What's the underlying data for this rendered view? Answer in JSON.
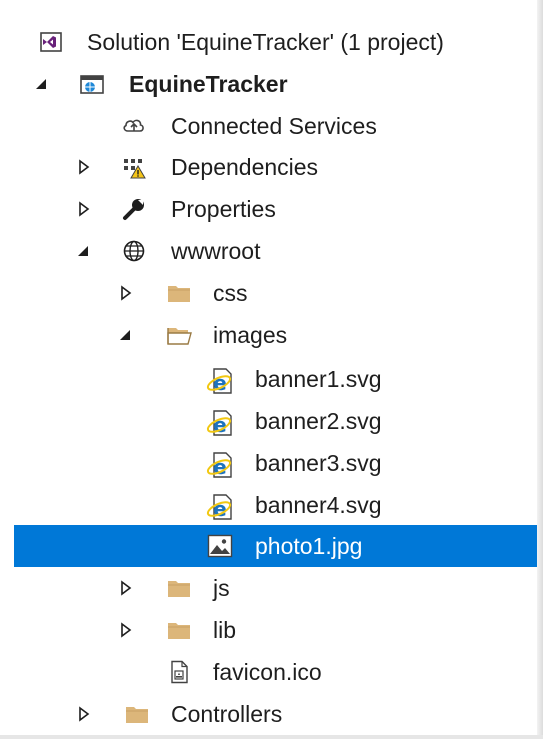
{
  "solution_explorer": {
    "solution": {
      "label": "Solution 'EquineTracker' (1 project)",
      "icon": "visual-studio-solution-icon"
    },
    "project": {
      "label": "EquineTracker",
      "icon": "web-project-icon",
      "expanded": true
    },
    "items": {
      "connected_services": {
        "label": "Connected Services",
        "icon": "connected-services-icon"
      },
      "dependencies": {
        "label": "Dependencies",
        "icon": "dependencies-warning-icon",
        "expanded": false
      },
      "properties": {
        "label": "Properties",
        "icon": "wrench-icon",
        "expanded": false
      },
      "wwwroot": {
        "label": "wwwroot",
        "icon": "globe-icon",
        "expanded": true
      },
      "css": {
        "label": "css",
        "icon": "folder-icon",
        "expanded": false
      },
      "images": {
        "label": "images",
        "icon": "open-folder-icon",
        "expanded": true
      },
      "banner1": {
        "label": "banner1.svg",
        "icon": "internet-explorer-file-icon"
      },
      "banner2": {
        "label": "banner2.svg",
        "icon": "internet-explorer-file-icon"
      },
      "banner3": {
        "label": "banner3.svg",
        "icon": "internet-explorer-file-icon"
      },
      "banner4": {
        "label": "banner4.svg",
        "icon": "internet-explorer-file-icon"
      },
      "photo1": {
        "label": "photo1.jpg",
        "icon": "image-file-icon",
        "selected": true
      },
      "js": {
        "label": "js",
        "icon": "folder-icon",
        "expanded": false
      },
      "lib": {
        "label": "lib",
        "icon": "folder-icon",
        "expanded": false
      },
      "favicon": {
        "label": "favicon.ico",
        "icon": "ico-file-icon"
      },
      "controllers": {
        "label": "Controllers",
        "icon": "folder-icon",
        "expanded": false
      }
    }
  },
  "colors": {
    "selection": "#0078d7",
    "folder": "#dcb67a",
    "vs_purple": "#68217a",
    "ie_blue": "#1e73be",
    "ie_ring": "#f2c811",
    "warning": "#f5c518"
  }
}
